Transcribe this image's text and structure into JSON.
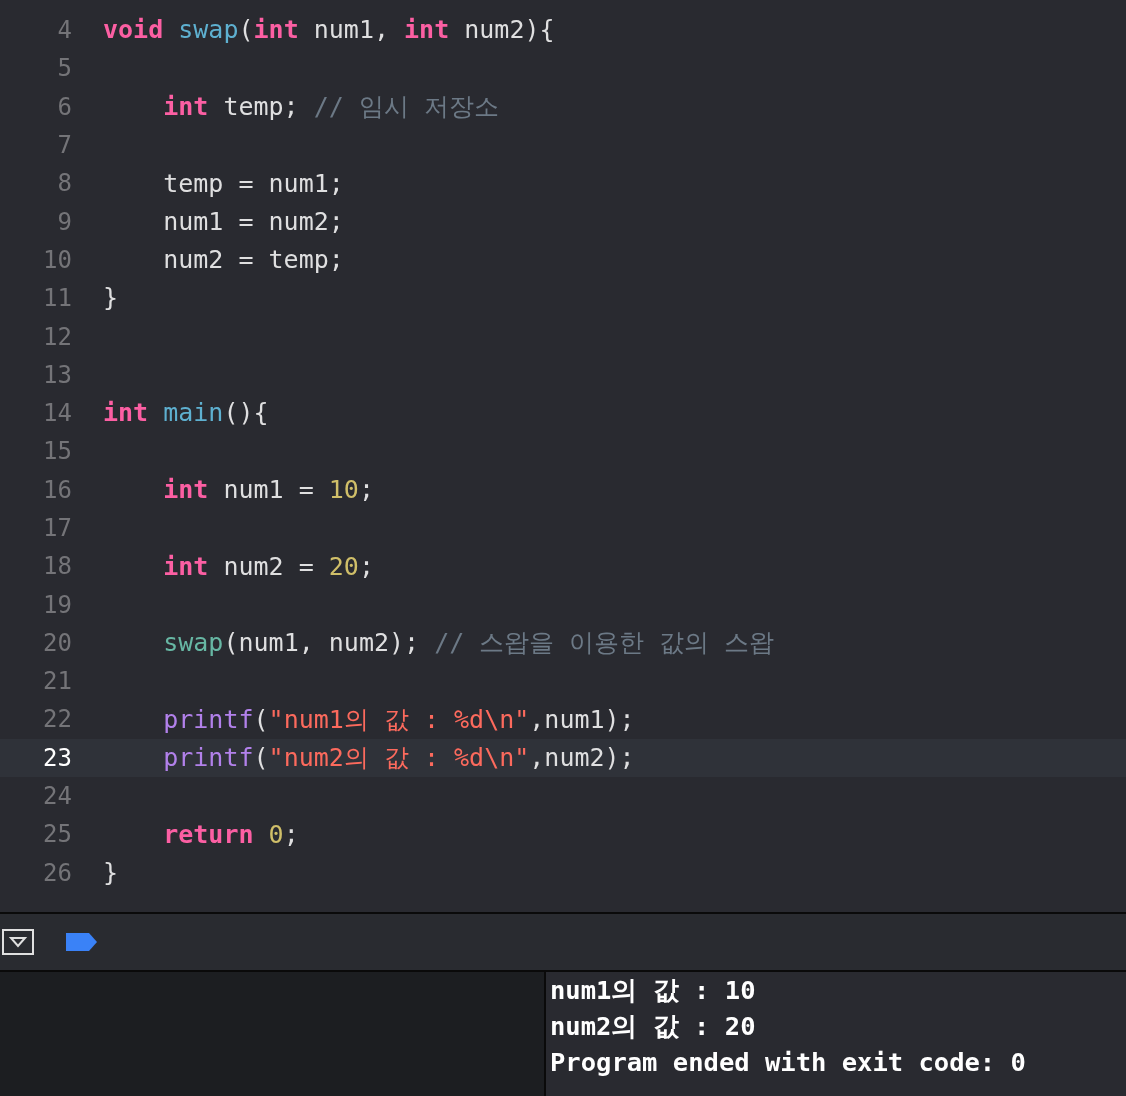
{
  "editor": {
    "lines": [
      {
        "number": "4",
        "selected": false,
        "indented": false,
        "tokens": [
          {
            "kind": "keyword",
            "text": "void"
          },
          {
            "kind": "declaration",
            "text": " swap"
          },
          {
            "kind": "plain",
            "text": "("
          },
          {
            "kind": "keyword",
            "text": "int"
          },
          {
            "kind": "plain",
            "text": " num1, "
          },
          {
            "kind": "keyword",
            "text": "int"
          },
          {
            "kind": "plain",
            "text": " num2){"
          }
        ]
      },
      {
        "number": "5",
        "selected": false
      },
      {
        "number": "6",
        "selected": false,
        "indented": true,
        "tokens": [
          {
            "kind": "keyword",
            "text": "int"
          },
          {
            "kind": "plain",
            "text": " temp; "
          },
          {
            "kind": "comment",
            "text": "// 임시 저장소"
          }
        ]
      },
      {
        "number": "7",
        "selected": false
      },
      {
        "number": "8",
        "selected": false,
        "indented": true,
        "tokens": [
          {
            "kind": "plain",
            "text": "temp = num1;"
          }
        ]
      },
      {
        "number": "9",
        "selected": false,
        "indented": true,
        "tokens": [
          {
            "kind": "plain",
            "text": "num1 = num2;"
          }
        ]
      },
      {
        "number": "10",
        "selected": false,
        "indented": true,
        "tokens": [
          {
            "kind": "plain",
            "text": "num2 = temp;"
          }
        ]
      },
      {
        "number": "11",
        "selected": false,
        "indented": false,
        "tokens": [
          {
            "kind": "plain",
            "text": "}"
          }
        ]
      },
      {
        "number": "12",
        "selected": false
      },
      {
        "number": "13",
        "selected": false
      },
      {
        "number": "14",
        "selected": false,
        "indented": false,
        "tokens": [
          {
            "kind": "keyword",
            "text": "int"
          },
          {
            "kind": "declaration",
            "text": " main"
          },
          {
            "kind": "plain",
            "text": "(){"
          }
        ]
      },
      {
        "number": "15",
        "selected": false
      },
      {
        "number": "16",
        "selected": false,
        "indented": true,
        "tokens": [
          {
            "kind": "keyword",
            "text": "int"
          },
          {
            "kind": "plain",
            "text": " num1 = "
          },
          {
            "kind": "number",
            "text": "10"
          },
          {
            "kind": "plain",
            "text": ";"
          }
        ]
      },
      {
        "number": "17",
        "selected": false
      },
      {
        "number": "18",
        "selected": false,
        "indented": true,
        "tokens": [
          {
            "kind": "keyword",
            "text": "int"
          },
          {
            "kind": "plain",
            "text": " num2 = "
          },
          {
            "kind": "number",
            "text": "20"
          },
          {
            "kind": "plain",
            "text": ";"
          }
        ]
      },
      {
        "number": "19",
        "selected": false
      },
      {
        "number": "20",
        "selected": false,
        "indented": true,
        "tokens": [
          {
            "kind": "call",
            "text": "swap"
          },
          {
            "kind": "plain",
            "text": "(num1, num2); "
          },
          {
            "kind": "comment",
            "text": "// 스왑을 이용한 값의 스왑"
          }
        ]
      },
      {
        "number": "21",
        "selected": false
      },
      {
        "number": "22",
        "selected": false,
        "indented": true,
        "tokens": [
          {
            "kind": "library",
            "text": "printf"
          },
          {
            "kind": "plain",
            "text": "("
          },
          {
            "kind": "string",
            "text": "\"num1의 값 : %d\\n\""
          },
          {
            "kind": "plain",
            "text": ",num1);"
          }
        ]
      },
      {
        "number": "23",
        "selected": true,
        "indented": true,
        "tokens": [
          {
            "kind": "library",
            "text": "printf"
          },
          {
            "kind": "plain",
            "text": "("
          },
          {
            "kind": "string",
            "text": "\"num2의 값 : %d\\n\""
          },
          {
            "kind": "plain",
            "text": ",num2);"
          }
        ]
      },
      {
        "number": "24",
        "selected": false
      },
      {
        "number": "25",
        "selected": false,
        "indented": true,
        "tokens": [
          {
            "kind": "keyword",
            "text": "return"
          },
          {
            "kind": "number",
            "text": " 0"
          },
          {
            "kind": "plain",
            "text": ";"
          }
        ]
      },
      {
        "number": "26",
        "selected": false,
        "indented": false,
        "tokens": [
          {
            "kind": "plain",
            "text": "}"
          }
        ]
      }
    ]
  },
  "debug_bar": {
    "breakpoints_active": true
  },
  "console": {
    "output": [
      "num1의 값 : 10",
      "num2의 값 : 20",
      "Program ended with exit code: 0"
    ]
  }
}
